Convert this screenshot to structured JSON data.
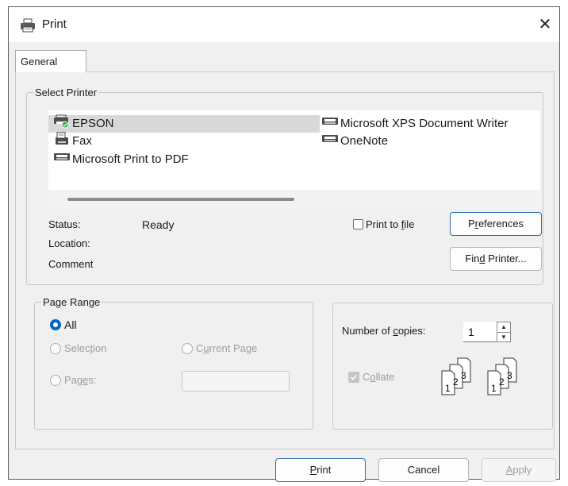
{
  "window": {
    "title": "Print",
    "close_glyph": "✕"
  },
  "tabs": [
    {
      "label": "General"
    }
  ],
  "select_printer": {
    "legend": "Select Printer",
    "printers": [
      {
        "name": "EPSON",
        "selected": true,
        "icon": "printer-default-icon"
      },
      {
        "name": "Fax",
        "selected": false,
        "icon": "fax-icon"
      },
      {
        "name": "Microsoft Print to PDF",
        "selected": false,
        "icon": "printer-icon"
      },
      {
        "name": "Microsoft XPS Document Writer",
        "selected": false,
        "icon": "printer-icon"
      },
      {
        "name": "OneNote",
        "selected": false,
        "icon": "printer-icon"
      }
    ],
    "status_label": "Status:",
    "status_value": "Ready",
    "location_label": "Location:",
    "location_value": "",
    "comment_label": "Comment",
    "comment_value": "",
    "print_to_file": {
      "label_before": "Print to ",
      "accel": "f",
      "label_after": "ile",
      "checked": false
    },
    "preferences": {
      "label_before": "P",
      "accel": "r",
      "label_after": "eferences"
    },
    "find_printer": {
      "label_before": "Fin",
      "accel": "d",
      "label_after": " Printer..."
    }
  },
  "page_range": {
    "legend": "Page Range",
    "all": {
      "label": "All",
      "checked": true
    },
    "selection": {
      "label_before": "Selec",
      "accel": "t",
      "label_after": "ion",
      "enabled": false
    },
    "current_page": {
      "label_before": "C",
      "accel": "u",
      "label_after": "rrent Page",
      "enabled": false
    },
    "pages": {
      "label_before": "Pag",
      "accel": "e",
      "label_after": "s:",
      "enabled": false,
      "value": ""
    }
  },
  "copies": {
    "label_before": "Number of ",
    "accel": "c",
    "label_after": "opies:",
    "value": "1",
    "collate": {
      "label_before": "C",
      "accel": "o",
      "label_after": "llate",
      "checked": true,
      "enabled": false
    },
    "collate_numbers": [
      "1",
      "2",
      "3",
      "1",
      "2",
      "3"
    ]
  },
  "buttons": {
    "print": {
      "label_before": "",
      "accel": "P",
      "label_after": "rint"
    },
    "cancel": {
      "label": "Cancel"
    },
    "apply": {
      "label_before": "",
      "accel": "A",
      "label_after": "pply",
      "enabled": false
    }
  }
}
